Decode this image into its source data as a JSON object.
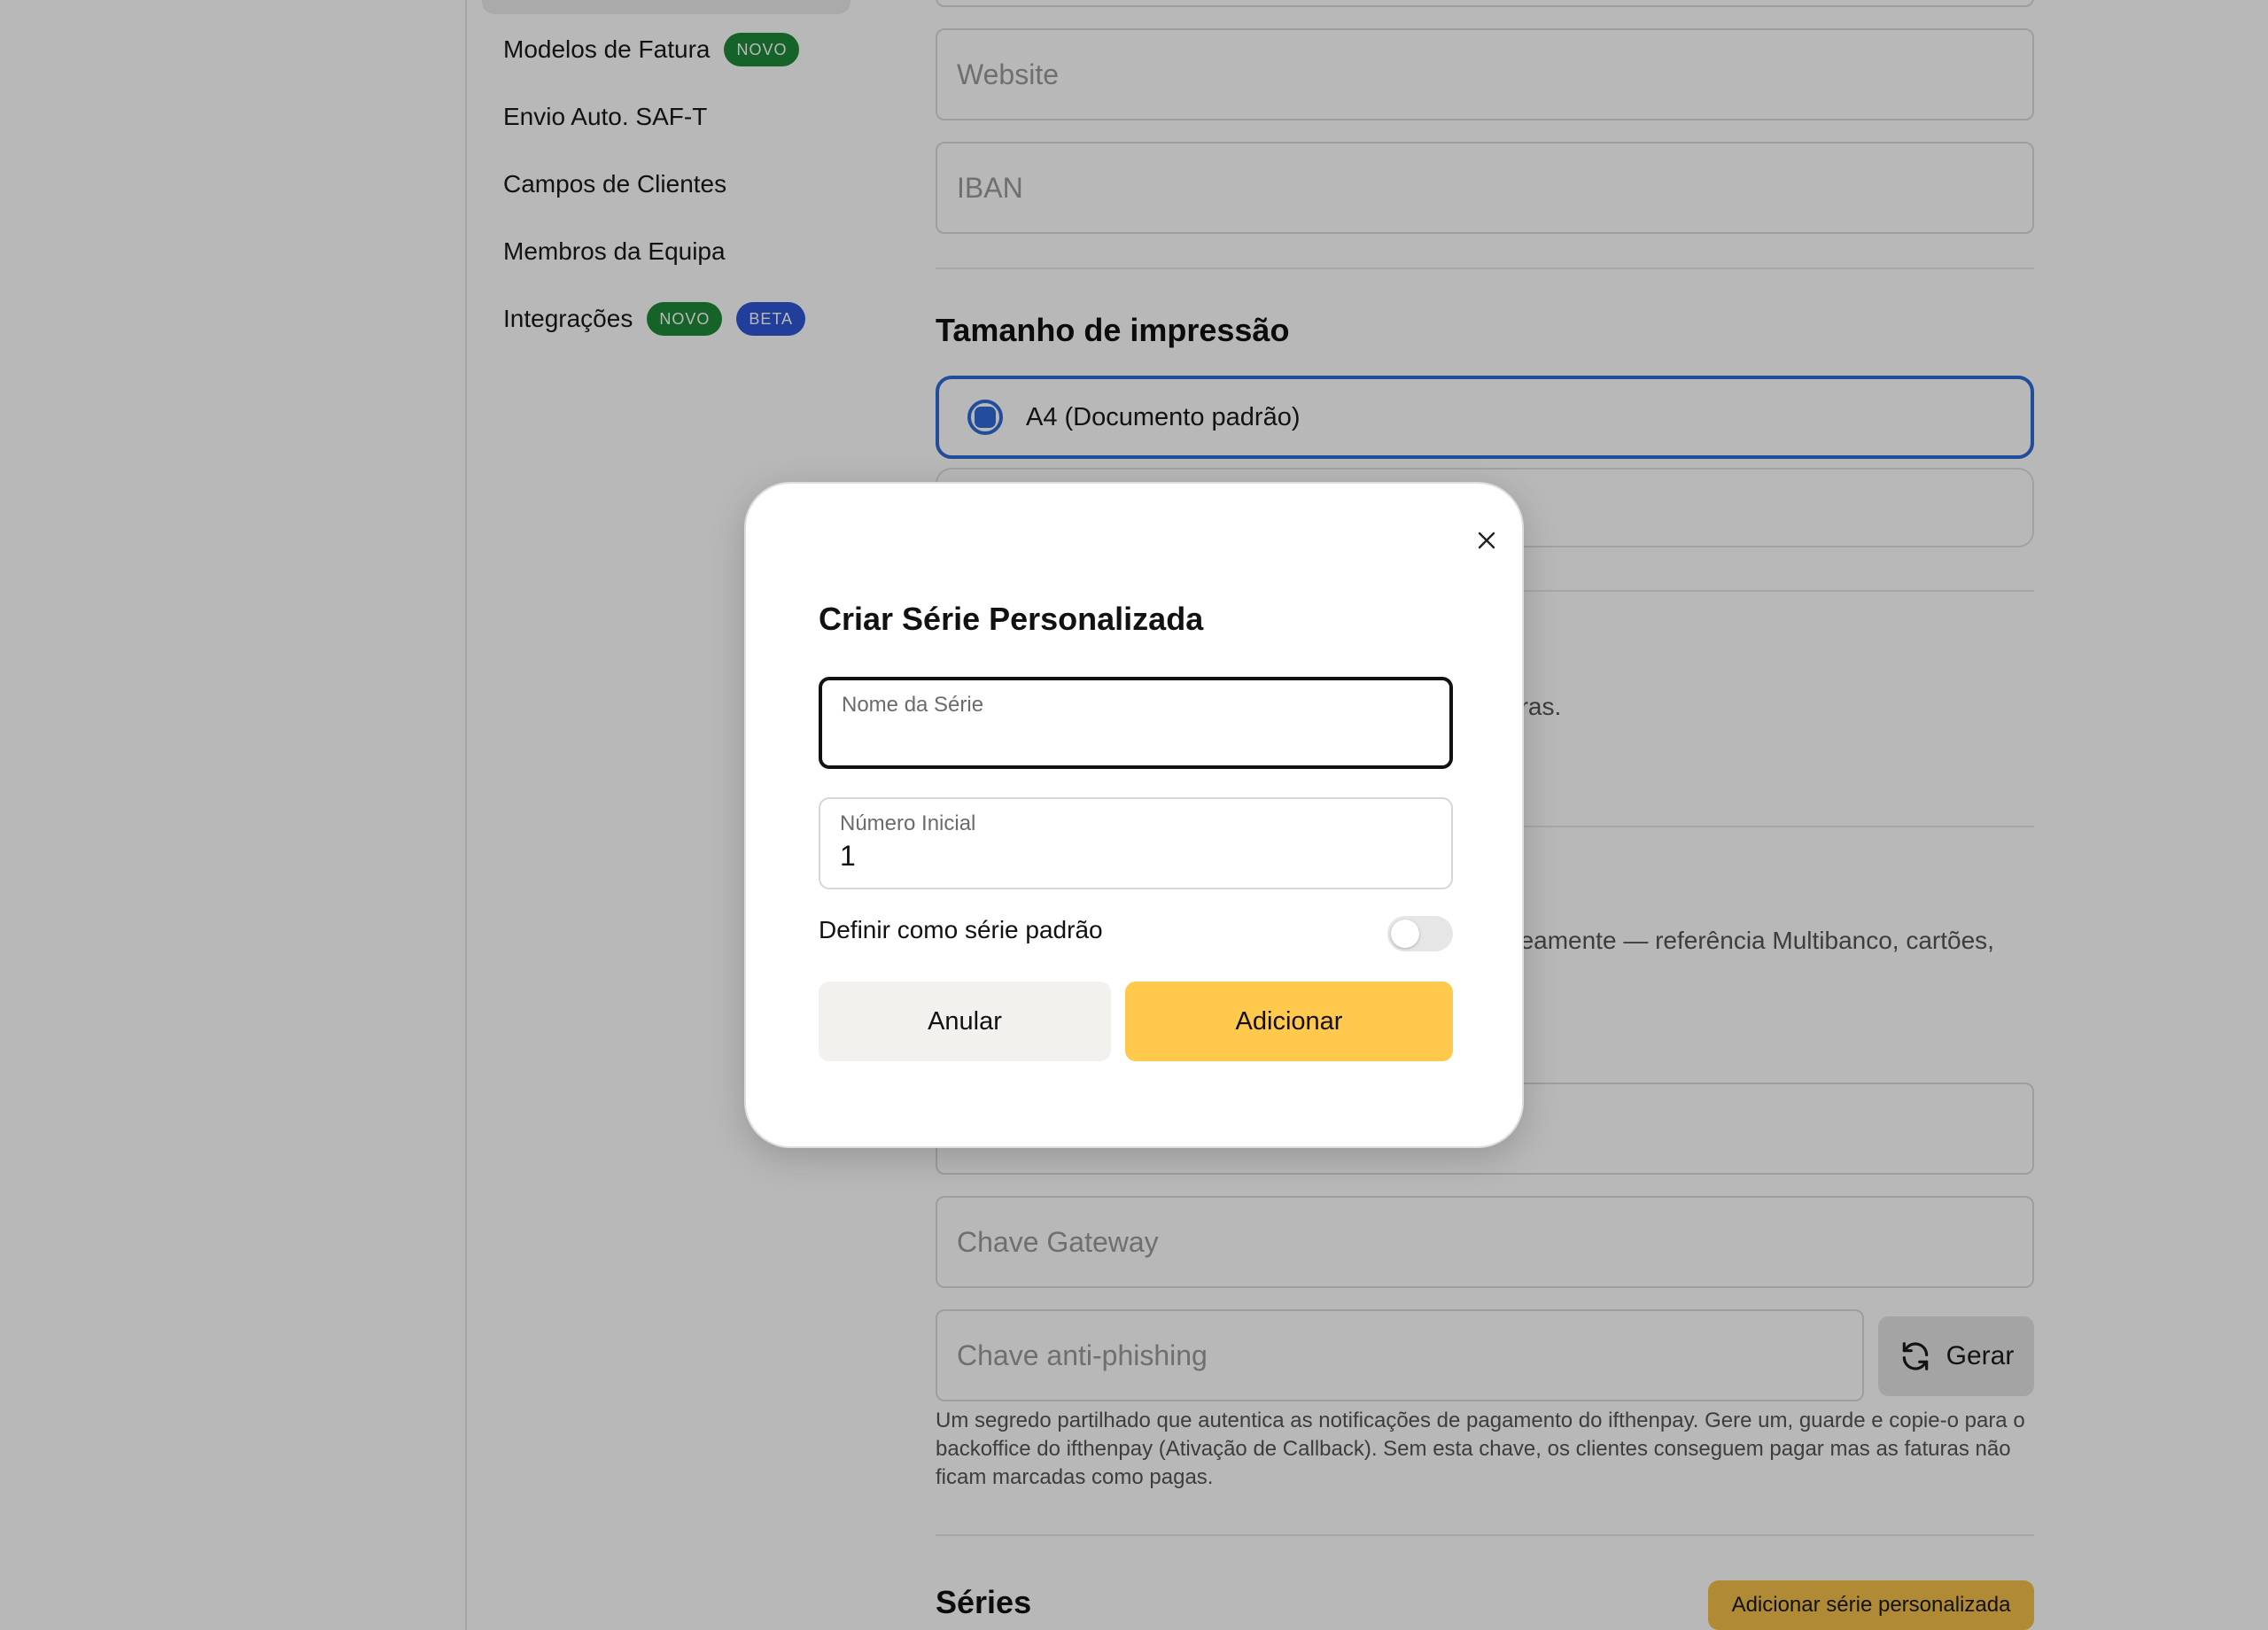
{
  "sidebar": {
    "items": [
      {
        "label": "Modelos de Fatura",
        "badges": [
          "NOVO"
        ]
      },
      {
        "label": "Envio Auto. SAF-T",
        "badges": []
      },
      {
        "label": "Campos de Clientes",
        "badges": []
      },
      {
        "label": "Membros da Equipa",
        "badges": []
      },
      {
        "label": "Integrações",
        "badges": [
          "NOVO",
          "BETA"
        ]
      }
    ]
  },
  "settings": {
    "website_placeholder": "Website",
    "iban_placeholder": "IBAN",
    "print_size": {
      "title": "Tamanho de impressão",
      "selected_option": "A4 (Documento padrão)"
    },
    "partial_text_1": "uras.",
    "partial_text_2": "neamente — referência Multibanco, cartões,",
    "gateway_key_placeholder": "Chave Gateway",
    "anti_phishing_placeholder": "Chave anti-phishing",
    "generate_label": "Gerar",
    "help_text": "Um segredo partilhado que autentica as notificações de pagamento do ifthenpay. Gere um, guarde e copie-o para o backoffice do ifthenpay (Ativação de Callback). Sem esta chave, os clientes conseguem pagar mas as faturas não ficam marcadas como pagas.",
    "series": {
      "title": "Séries",
      "add_label": "Adicionar série personalizada"
    }
  },
  "modal": {
    "title": "Criar Série Personalizada",
    "series_name_label": "Nome da Série",
    "series_name_value": "",
    "start_number_label": "Número Inicial",
    "start_number_value": "1",
    "default_toggle_label": "Definir como série padrão",
    "default_toggle_on": false,
    "cancel_label": "Anular",
    "add_label": "Adicionar"
  },
  "colors": {
    "accent_yellow": "#ffc94e",
    "badge_green": "#1f8a3b",
    "badge_blue": "#2f56d6",
    "radio_blue": "#2f6bd8"
  }
}
